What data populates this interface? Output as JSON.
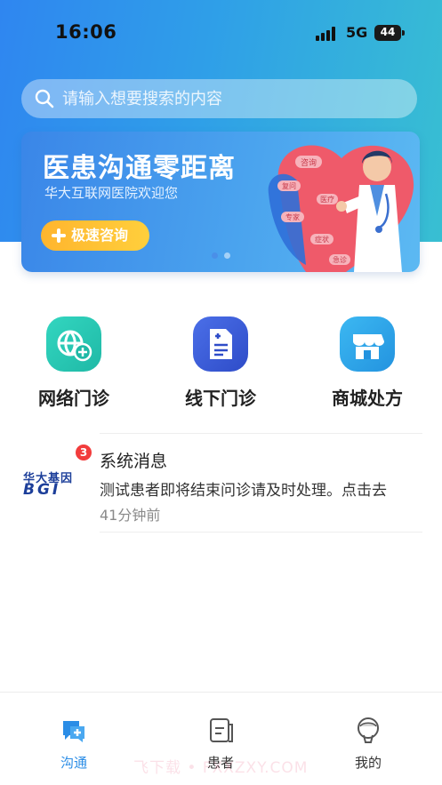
{
  "status_bar": {
    "time": "16:06",
    "network": "5G",
    "battery": "44"
  },
  "search": {
    "placeholder": "请输入想要搜索的内容"
  },
  "banner": {
    "title": "医患沟通零距离",
    "subtitle": "华大互联网医院欢迎您",
    "button_label": "极速咨询",
    "heart_tags": [
      "咨询",
      "复问",
      "专家",
      "症状",
      "医疗",
      "急诊"
    ]
  },
  "entries": [
    {
      "label": "网络门诊",
      "icon": "online-clinic-icon",
      "color": "#26cbb5"
    },
    {
      "label": "线下门诊",
      "icon": "offline-clinic-icon",
      "color": "#3d5fd9"
    },
    {
      "label": "商城处方",
      "icon": "store-prescription-icon",
      "color": "#2fa3e8"
    }
  ],
  "message": {
    "logo_cn": "华大基因",
    "logo_en": "BGI",
    "badge": "3",
    "title": "系统消息",
    "preview": "测试患者即将结束问诊请及时处理。点击去",
    "time": "41分钟前"
  },
  "tabs": [
    {
      "label": "沟通",
      "active": true
    },
    {
      "label": "患者",
      "active": false
    },
    {
      "label": "我的",
      "active": false
    }
  ],
  "watermark": "飞下载 • FXXZXY.COM",
  "colors": {
    "accent": "#2b8de6",
    "badge": "#f23c3c",
    "consult_button": "#ffbf35"
  }
}
